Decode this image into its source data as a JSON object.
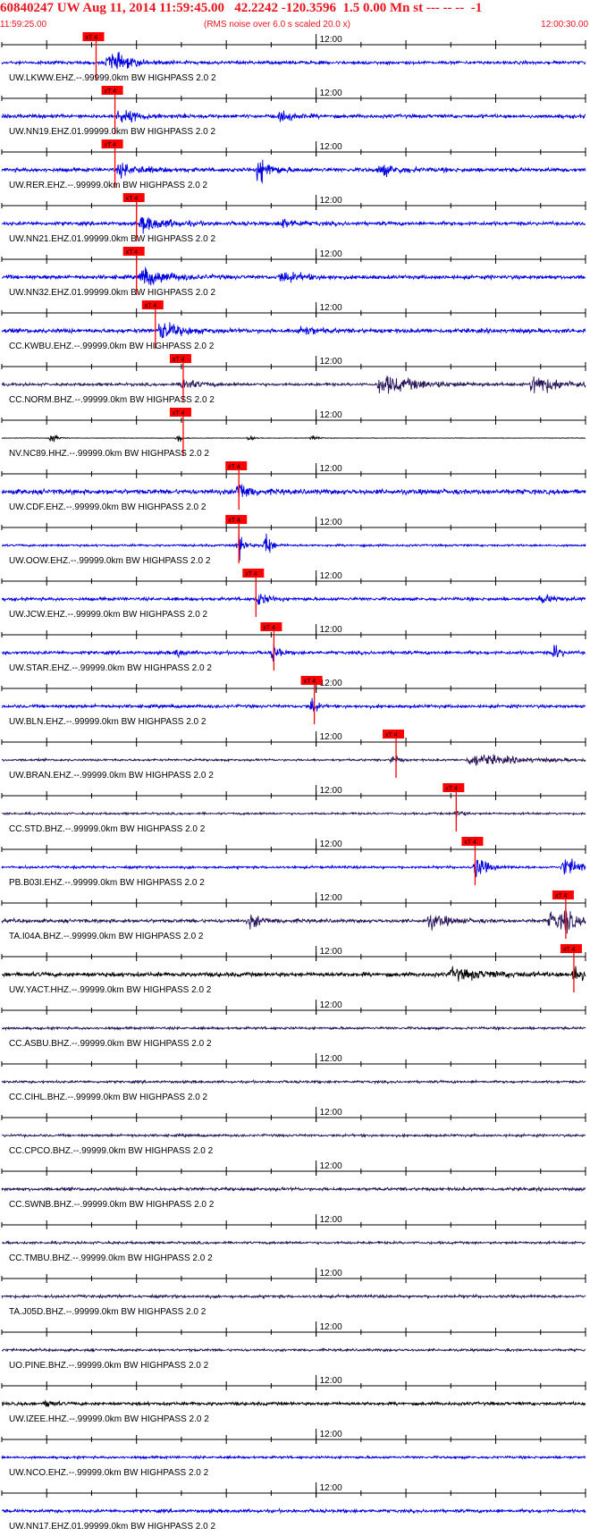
{
  "header": {
    "title": "60840247 UW Aug 11, 2014 11:59:45.00   42.2242 -120.3596  1.5 0.00 Mn st --- -- --  -1",
    "start_time": "11:59:25.00",
    "note": "(RMS noise over 6.0 s scaled 20.0 x)",
    "end_time": "12:00:30.00"
  },
  "colors": {
    "title_red": "#e8141e",
    "pick_red": "#ff0000",
    "trace_blue": "#0000e0",
    "trace_navy": "#28145a",
    "trace_black": "#000000",
    "axis": "#000000"
  },
  "chart_data": {
    "type": "line",
    "title": "60840247 UW Aug 11, 2014 11:59:45.00   42.2242 -120.3596  1.5 0.00 Mn st --- -- --  -1",
    "x_range": [
      "11:59:25.00",
      "12:00:30.00"
    ],
    "x_tick_label": "12:00",
    "minor_tick_interval_s": 5,
    "pick_label": "xT 4",
    "traces": [
      {
        "label": "UW.LKWW.EHZ.--.99999.0km BW  HIGHPASS  2.0  2",
        "color": "blue",
        "pick_s": 10.5,
        "amp": 0.45,
        "events": [
          {
            "t": 11.8,
            "amp": 3.5,
            "dur": 4
          }
        ]
      },
      {
        "label": "UW.NN19.EHZ.01.99999.0km BW  HIGHPASS  2.0  2",
        "color": "blue",
        "pick_s": 12.6,
        "amp": 0.5,
        "events": [
          {
            "t": 13,
            "amp": 2.2,
            "dur": 4
          },
          {
            "t": 31,
            "amp": 1.6,
            "dur": 3
          }
        ]
      },
      {
        "label": "UW.RER.EHZ.--.99999.0km BW  HIGHPASS  2.0  2",
        "color": "blue",
        "pick_s": 12.6,
        "amp": 0.55,
        "events": [
          {
            "t": 13,
            "amp": 1.8,
            "dur": 5
          },
          {
            "t": 28.5,
            "amp": 4.5,
            "dur": 2.5
          },
          {
            "t": 42,
            "amp": 1.8,
            "dur": 4
          }
        ]
      },
      {
        "label": "UW.NN21.EHZ.01.99999.0km BW  HIGHPASS  2.0  2",
        "color": "blue",
        "pick_s": 15,
        "amp": 0.5,
        "events": [
          {
            "t": 15.5,
            "amp": 2.5,
            "dur": 5
          },
          {
            "t": 31,
            "amp": 1.6,
            "dur": 3
          }
        ]
      },
      {
        "label": "UW.NN32.EHZ.01.99999.0km BW  HIGHPASS  2.0  2",
        "color": "blue",
        "pick_s": 15,
        "amp": 0.55,
        "events": [
          {
            "t": 15.5,
            "amp": 3.0,
            "dur": 5
          },
          {
            "t": 31,
            "amp": 1.8,
            "dur": 4
          }
        ]
      },
      {
        "label": "CC.KWBU.EHZ.--.99999.0km BW  HIGHPASS  2.0  2",
        "color": "blue",
        "pick_s": 17.1,
        "amp": 0.6,
        "events": [
          {
            "t": 17.5,
            "amp": 2.8,
            "dur": 4
          },
          {
            "t": 33,
            "amp": 1.6,
            "dur": 3
          }
        ]
      },
      {
        "label": "CC.NORM.BHZ.--.99999.0km BW  HIGHPASS  2.0  2",
        "color": "navy",
        "pick_s": 20.2,
        "amp": 0.4,
        "events": [
          {
            "t": 20,
            "amp": 2.0,
            "dur": 3
          },
          {
            "t": 42,
            "amp": 3.0,
            "dur": 8
          },
          {
            "t": 59,
            "amp": 3.5,
            "dur": 5
          }
        ]
      },
      {
        "label": "NV.NC89.HHZ.--.99999.0km BW  HIGHPASS  2.0  2",
        "color": "black",
        "pick_s": 20.2,
        "amp": 0.08,
        "events": [
          {
            "t": 5.5,
            "amp": 2.5,
            "dur": 0.6
          },
          {
            "t": 19.5,
            "amp": 2.2,
            "dur": 0.6
          },
          {
            "t": 27.5,
            "amp": 1.8,
            "dur": 0.6
          },
          {
            "t": 34.5,
            "amp": 1.4,
            "dur": 0.6
          }
        ]
      },
      {
        "label": "UW.CDF.EHZ.--.99999.0km BW  HIGHPASS  2.0  2",
        "color": "blue",
        "pick_s": 26.4,
        "amp": 0.7,
        "events": [
          {
            "t": 26.2,
            "amp": 4.0,
            "dur": 2
          }
        ]
      },
      {
        "label": "UW.OOW.EHZ.--.99999.0km BW  HIGHPASS  2.0  2",
        "color": "blue",
        "pick_s": 26.4,
        "amp": 0.3,
        "events": [
          {
            "t": 26.3,
            "amp": 6,
            "dur": 1
          },
          {
            "t": 29.3,
            "amp": 6,
            "dur": 1
          }
        ]
      },
      {
        "label": "UW.JCW.EHZ.--.99999.0km BW  HIGHPASS  2.0  2",
        "color": "blue",
        "pick_s": 28.3,
        "amp": 0.45,
        "events": [
          {
            "t": 28.5,
            "amp": 2.2,
            "dur": 2
          },
          {
            "t": 60,
            "amp": 1.4,
            "dur": 3
          }
        ]
      },
      {
        "label": "UW.STAR.EHZ.--.99999.0km BW  HIGHPASS  2.0  2",
        "color": "blue",
        "pick_s": 30.3,
        "amp": 0.45,
        "events": [
          {
            "t": 19.5,
            "amp": 1.8,
            "dur": 1
          },
          {
            "t": 30.2,
            "amp": 4.0,
            "dur": 1
          },
          {
            "t": 61.5,
            "amp": 3.5,
            "dur": 1
          }
        ]
      },
      {
        "label": "UW.BLN.EHZ.--.99999.0km BW  HIGHPASS  2.0  2",
        "color": "blue",
        "pick_s": 34.8,
        "amp": 0.45,
        "events": [
          {
            "t": 34.5,
            "amp": 4.5,
            "dur": 0.6
          }
        ]
      },
      {
        "label": "UW.BRAN.EHZ.--.99999.0km BW  HIGHPASS  2.0  2",
        "color": "navy",
        "pick_s": 43.9,
        "amp": 0.3,
        "events": [
          {
            "t": 43.5,
            "amp": 2.5,
            "dur": 1
          },
          {
            "t": 52,
            "amp": 1.8,
            "dur": 10
          }
        ]
      },
      {
        "label": "CC.STD.BHZ.--.99999.0km BW  HIGHPASS  2.0  2",
        "color": "navy",
        "pick_s": 50.6,
        "amp": 0.3,
        "events": [
          {
            "t": 50.6,
            "amp": 2.2,
            "dur": 1
          }
        ]
      },
      {
        "label": "PB.B03I.EHZ.--.99999.0km BW  HIGHPASS  2.0  2",
        "color": "blue",
        "pick_s": 52.7,
        "amp": 0.35,
        "events": [
          {
            "t": 52.7,
            "amp": 4.0,
            "dur": 2
          },
          {
            "t": 62.5,
            "amp": 3.0,
            "dur": 4
          }
        ]
      },
      {
        "label": "TA.I04A.BHZ.--.99999.0km BW  HIGHPASS  2.0  2",
        "color": "navy",
        "pick_s": 62.8,
        "amp": 0.5,
        "events": [
          {
            "t": 27.5,
            "amp": 2.2,
            "dur": 3
          },
          {
            "t": 47.5,
            "amp": 2.2,
            "dur": 4
          },
          {
            "t": 61,
            "amp": 3.0,
            "dur": 4
          },
          {
            "t": 62.8,
            "amp": 5,
            "dur": 1
          }
        ]
      },
      {
        "label": "UW.YACT.HHZ.--.99999.0km BW  HIGHPASS  2.0  2",
        "color": "black",
        "pick_s": 63.7,
        "amp": 0.6,
        "events": [
          {
            "t": 50,
            "amp": 1.6,
            "dur": 8
          },
          {
            "t": 63.7,
            "amp": 4.0,
            "dur": 1.5
          }
        ]
      },
      {
        "label": "CC.ASBU.BHZ.--.99999.0km BW  HIGHPASS  2.0  2",
        "color": "navy",
        "amp": 0.35,
        "events": []
      },
      {
        "label": "CC.CIHL.BHZ.--.99999.0km BW  HIGHPASS  2.0  2",
        "color": "navy",
        "amp": 0.35,
        "events": []
      },
      {
        "label": "CC.CPCO.BHZ.--.99999.0km BW  HIGHPASS  2.0  2",
        "color": "navy",
        "amp": 0.35,
        "events": []
      },
      {
        "label": "CC.SWNB.BHZ.--.99999.0km BW  HIGHPASS  2.0  2",
        "color": "navy",
        "amp": 0.45,
        "events": []
      },
      {
        "label": "CC.TMBU.BHZ.--.99999.0km BW  HIGHPASS  2.0  2",
        "color": "navy",
        "amp": 0.35,
        "events": []
      },
      {
        "label": "TA.J05D.BHZ.--.99999.0km BW  HIGHPASS  2.0  2",
        "color": "navy",
        "amp": 0.4,
        "events": []
      },
      {
        "label": "UO.PINE.BHZ.--.99999.0km BW  HIGHPASS  2.0  2",
        "color": "navy",
        "amp": 0.35,
        "events": []
      },
      {
        "label": "UW.IZEE.HHZ.--.99999.0km BW  HIGHPASS  2.0  2",
        "color": "black",
        "amp": 0.45,
        "events": [
          {
            "t": 5,
            "amp": 1.8,
            "dur": 1
          }
        ]
      },
      {
        "label": "UW.NCO.EHZ.--.99999.0km BW  HIGHPASS  2.0  2",
        "color": "blue",
        "amp": 0.35,
        "events": []
      },
      {
        "label": "UW.NN17.EHZ.01.99999.0km BW  HIGHPASS  2.0  2",
        "color": "blue",
        "amp": 0.45,
        "events": []
      }
    ]
  }
}
